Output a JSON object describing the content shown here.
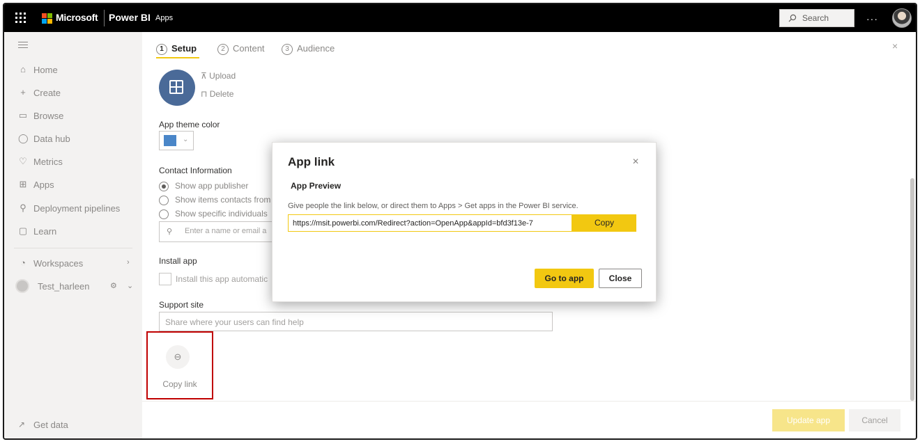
{
  "topbar": {
    "brand_microsoft": "Microsoft",
    "brand_product": "Power BI",
    "section": "Apps",
    "search_placeholder": "Search",
    "more_label": "···"
  },
  "sidebar": {
    "items": [
      {
        "label": "Home",
        "icon": "home-icon"
      },
      {
        "label": "Create",
        "icon": "plus-icon"
      },
      {
        "label": "Browse",
        "icon": "folder-icon"
      },
      {
        "label": "Data hub",
        "icon": "database-icon"
      },
      {
        "label": "Metrics",
        "icon": "trophy-icon"
      },
      {
        "label": "Apps",
        "icon": "apps-icon"
      },
      {
        "label": "Deployment pipelines",
        "icon": "rocket-icon"
      },
      {
        "label": "Learn",
        "icon": "book-icon"
      }
    ],
    "workspaces_label": "Workspaces",
    "workspace_name": "Test_harleen",
    "get_data_label": "Get data"
  },
  "steps": [
    {
      "num": "1",
      "label": "Setup",
      "active": true
    },
    {
      "num": "2",
      "label": "Content",
      "active": false
    },
    {
      "num": "3",
      "label": "Audience",
      "active": false
    }
  ],
  "setup": {
    "upload_label": "Upload",
    "delete_label": "Delete",
    "theme_color_label": "App theme color",
    "theme_color": "#4a86c8",
    "contact_label": "Contact Information",
    "contact_options": [
      {
        "label": "Show app publisher",
        "selected": true
      },
      {
        "label": "Show items contacts from",
        "selected": false
      },
      {
        "label": "Show specific individuals",
        "selected": false
      }
    ],
    "people_placeholder": "Enter a name or email a",
    "install_label": "Install app",
    "install_checkbox_label": "Install this app automatic",
    "support_label": "Support site",
    "support_placeholder": "Share where your users can find help",
    "copy_link_label": "Copy link",
    "update_button": "Update app",
    "cancel_button": "Cancel"
  },
  "dialog": {
    "title": "App link",
    "subtitle": "App Preview",
    "description": "Give people the link below, or direct them to Apps > Get apps in the Power BI service.",
    "url": "https://msit.powerbi.com/Redirect?action=OpenApp&appId=bfd3f13e-7",
    "copy_button": "Copy",
    "go_button": "Go to app",
    "close_button": "Close"
  },
  "colors": {
    "accent": "#f2c811",
    "highlight_box": "#c00000",
    "app_icon": "#4a6a98"
  }
}
